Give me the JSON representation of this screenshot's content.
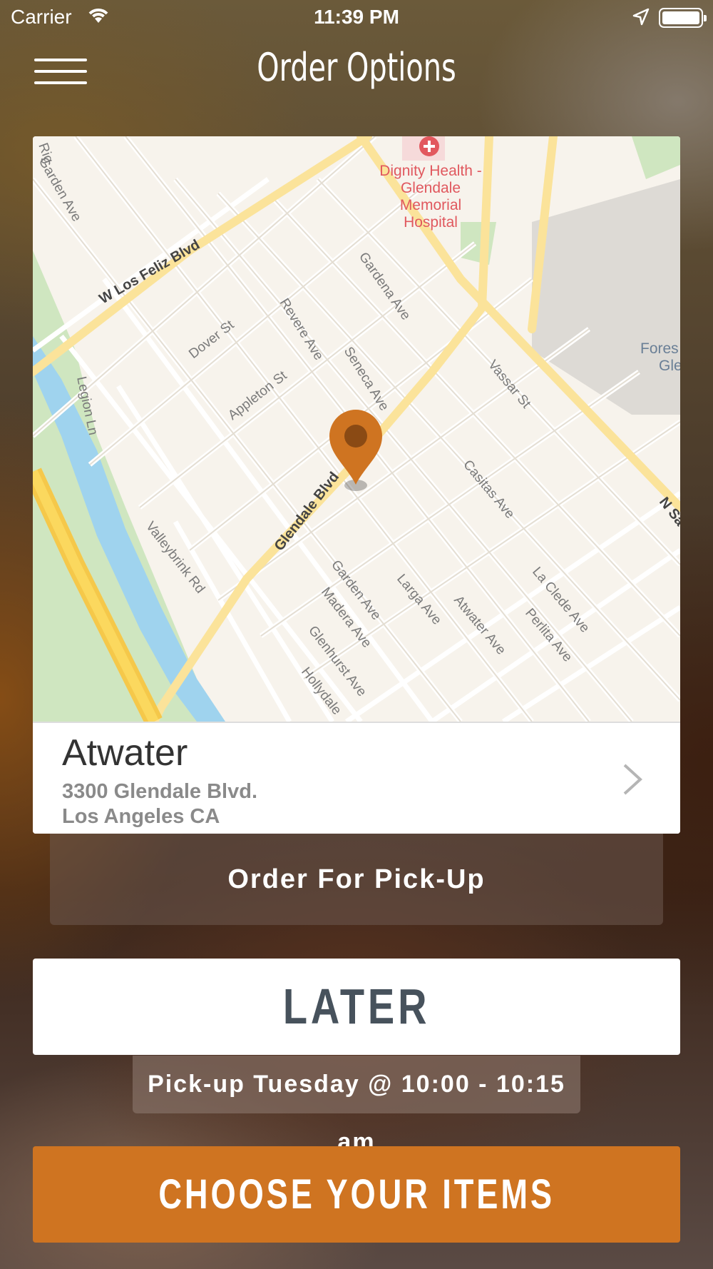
{
  "status_bar": {
    "carrier": "Carrier",
    "time": "11:39 PM",
    "icons": [
      "wifi-icon",
      "location-arrow-icon",
      "battery-icon"
    ]
  },
  "header": {
    "title": "Order Options",
    "menu_icon": "hamburger-menu-icon"
  },
  "map": {
    "pin_icon": "map-pin-icon",
    "pin_color": "#cf7421",
    "labels": {
      "hospital_1": "Dignity Health -",
      "hospital_2": "Glendale",
      "hospital_3": "Memorial",
      "hospital_4": "Hospital",
      "w_los_feliz": "W Los Feliz Blvd",
      "garden_ave_top": "Garden Ave",
      "gardena": "Gardena Ave",
      "dover": "Dover St",
      "revere": "Revere Ave",
      "seneca": "Seneca Ave",
      "appleton": "Appleton St",
      "legion": "Legion Ln",
      "vassar": "Vassar St",
      "forest_1": "Fores",
      "forest_2": "Gle",
      "glendale_blvd": "Glendale Blvd",
      "casitas": "Casitas Ave",
      "n_san": "N Sa",
      "valleybrink": "Valleybrink Rd",
      "garden_ave": "Garden Ave",
      "larga": "Larga Ave",
      "la_clede": "La Clede Ave",
      "madera": "Madera Ave",
      "atwater": "Atwater Ave",
      "perlita": "Perlita Ave",
      "glenhurst": "Glenhurst Ave",
      "hollydale": "Hollydale",
      "rig": "Rig"
    }
  },
  "location": {
    "name": "Atwater",
    "address_line1": "3300 Glendale Blvd.",
    "address_line2": "Los Angeles CA",
    "chevron_icon": "chevron-right-icon"
  },
  "order_mode": {
    "label": "Order For Pick-Up"
  },
  "timing": {
    "button_label": "LATER",
    "pickup_text": "Pick-up Tuesday @ 10:00 - 10:15 am"
  },
  "cta": {
    "label": "CHOOSE YOUR ITEMS",
    "color": "#cf7421"
  }
}
